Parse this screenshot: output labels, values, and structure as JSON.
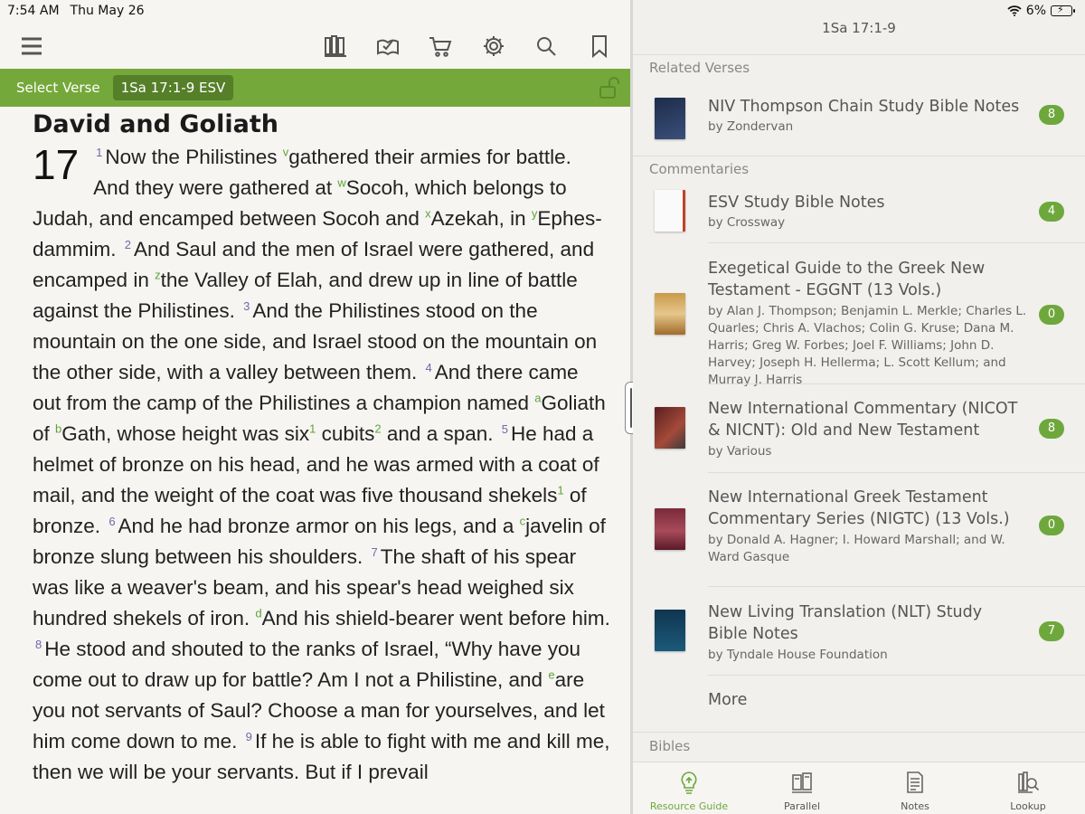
{
  "status": {
    "time": "7:54 AM",
    "date": "Thu May 26",
    "battery": "6%"
  },
  "verse_bar": {
    "select_label": "Select Verse",
    "reference": "1Sa 17:1-9 ESV"
  },
  "passage": {
    "heading": "David and Goliath",
    "chapter": "17",
    "text": [
      {
        "t": "vn",
        "v": "1"
      },
      {
        "t": "txt",
        "v": "Now the Philistines "
      },
      {
        "t": "xr",
        "v": "v"
      },
      {
        "t": "txt",
        "v": "gathered their armies for battle. And they were gathered at "
      },
      {
        "t": "xr",
        "v": "w"
      },
      {
        "t": "txt",
        "v": "Socoh, which belongs to Judah, and encamped between Socoh and "
      },
      {
        "t": "xr",
        "v": "x"
      },
      {
        "t": "txt",
        "v": "Azekah, in "
      },
      {
        "t": "xr",
        "v": "y"
      },
      {
        "t": "txt",
        "v": "Ephes-dammim. "
      },
      {
        "t": "vn",
        "v": "2"
      },
      {
        "t": "txt",
        "v": "And Saul and the men of Israel were gathered, and encamped in "
      },
      {
        "t": "xr",
        "v": "z"
      },
      {
        "t": "txt",
        "v": "the Valley of Elah, and drew up in line of battle against the Philistines. "
      },
      {
        "t": "vn",
        "v": "3"
      },
      {
        "t": "txt",
        "v": "And the Philistines stood on the mountain on the one side, and Israel stood on the mountain on the other side, with a valley between them. "
      },
      {
        "t": "vn",
        "v": "4"
      },
      {
        "t": "txt",
        "v": "And there came out from the camp of the Philistines a champion named "
      },
      {
        "t": "xr",
        "v": "a"
      },
      {
        "t": "txt",
        "v": "Goliath of "
      },
      {
        "t": "xr",
        "v": "b"
      },
      {
        "t": "txt",
        "v": "Gath, whose height was six"
      },
      {
        "t": "fn",
        "v": "1"
      },
      {
        "t": "txt",
        "v": " cubits"
      },
      {
        "t": "fn",
        "v": "2"
      },
      {
        "t": "txt",
        "v": " and a span. "
      },
      {
        "t": "vn",
        "v": "5"
      },
      {
        "t": "txt",
        "v": "He had a helmet of bronze on his head, and he was armed with a coat of mail, and the weight of the coat was five thousand shekels"
      },
      {
        "t": "fn",
        "v": "1"
      },
      {
        "t": "txt",
        "v": " of bronze. "
      },
      {
        "t": "vn",
        "v": "6"
      },
      {
        "t": "txt",
        "v": "And he had bronze armor on his legs, and a "
      },
      {
        "t": "xr",
        "v": "c"
      },
      {
        "t": "txt",
        "v": "javelin of bronze slung between his shoulders. "
      },
      {
        "t": "vn",
        "v": "7"
      },
      {
        "t": "txt",
        "v": "The shaft of his spear was like a weaver's beam, and his spear's head weighed six hundred shekels of iron. "
      },
      {
        "t": "xr",
        "v": "d"
      },
      {
        "t": "txt",
        "v": "And his shield-bearer went before him. "
      },
      {
        "t": "vn",
        "v": "8"
      },
      {
        "t": "txt",
        "v": "He stood and shouted to the ranks of Israel, “Why have you come out to draw up for battle? Am I not a Philistine, and "
      },
      {
        "t": "xr",
        "v": "e"
      },
      {
        "t": "txt",
        "v": "are you not servants of Saul? Choose a man for yourselves, and let him come down to me. "
      },
      {
        "t": "vn",
        "v": "9"
      },
      {
        "t": "txt",
        "v": "If he is able to fight with me and kill me, then we will be your servants. But if I prevail"
      }
    ]
  },
  "right_panel": {
    "title": "1Sa 17:1-9",
    "sections": {
      "related": "Related Verses",
      "commentaries": "Commentaries",
      "bibles": "Bibles"
    },
    "related_items": [
      {
        "title": "NIV Thompson Chain Study Bible Notes",
        "by": "by Zondervan",
        "count": "8"
      }
    ],
    "commentary_items": [
      {
        "title": "ESV Study Bible Notes",
        "by": "by Crossway",
        "count": "4"
      },
      {
        "title": "Exegetical Guide to the Greek New Testament - EGGNT (13 Vols.)",
        "by": "by Alan J. Thompson; Benjamin L. Merkle; Charles L. Quarles; Chris A. Vlachos; Colin G. Kruse; Dana M. Harris; Greg W. Forbes; Joel F. Williams; John D. Harvey; Joseph H. Hellerma; L. Scott Kellum; and Murray J. Harris",
        "count": "0"
      },
      {
        "title": "New International Commentary (NICOT & NICNT): Old and New Testament",
        "by": "by Various",
        "count": "8"
      },
      {
        "title": "New International Greek Testament Commentary Series (NIGTC) (13 Vols.)",
        "by": "by Donald A. Hagner; I. Howard Marshall; and W. Ward Gasque",
        "count": "0"
      },
      {
        "title": "New Living Translation (NLT) Study Bible Notes",
        "by": "by Tyndale House Foundation",
        "count": "7"
      }
    ],
    "more_label": "More"
  },
  "tabs": [
    {
      "label": "Resource Guide",
      "icon": "lightbulb-icon",
      "active": true
    },
    {
      "label": "Parallel",
      "icon": "books-icon",
      "active": false
    },
    {
      "label": "Notes",
      "icon": "notes-icon",
      "active": false
    },
    {
      "label": "Lookup",
      "icon": "lookup-icon",
      "active": false
    }
  ],
  "colors": {
    "accent_green": "#75a83a",
    "badge_green": "#6ea83c",
    "chip_green": "#567f29"
  }
}
